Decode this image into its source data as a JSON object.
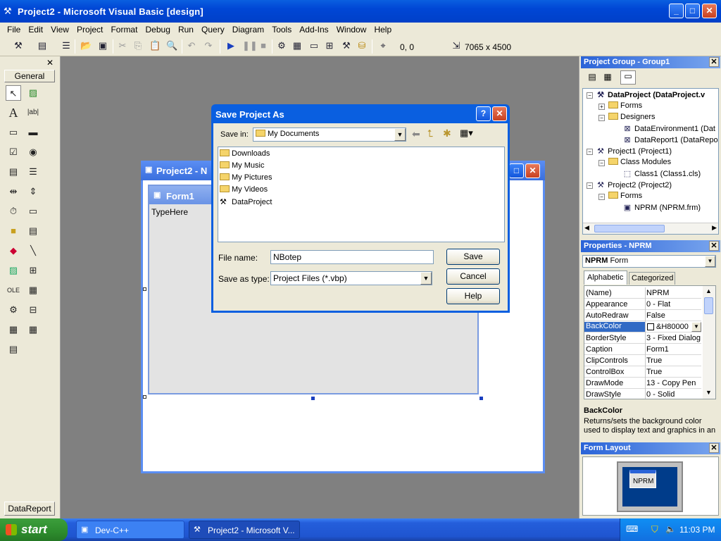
{
  "window": {
    "title": "Project2 - Microsoft Visual Basic [design]"
  },
  "menu": [
    "File",
    "Edit",
    "View",
    "Project",
    "Format",
    "Debug",
    "Run",
    "Query",
    "Diagram",
    "Tools",
    "Add-Ins",
    "Window",
    "Help"
  ],
  "toolbar": {
    "position": "0, 0",
    "size": "7065 x 4500"
  },
  "toolbox": {
    "tab_label": "General",
    "bottom_label": "DataReport"
  },
  "project_window": {
    "title": "Project2 - N",
    "form_title": "Form1",
    "form_text": "TypeHere"
  },
  "dialog": {
    "title": "Save Project As",
    "save_in_label": "Save in:",
    "save_in_value": "My Documents",
    "files": [
      "Downloads",
      "My Music",
      "My Pictures",
      "My Videos",
      "DataProject"
    ],
    "file_name_label": "File name:",
    "file_name_value": "NBotep",
    "save_type_label": "Save as type:",
    "save_type_value": "Project Files (*.vbp)",
    "save_button": "Save",
    "cancel_button": "Cancel",
    "help_button": "Help"
  },
  "project_group": {
    "title": "Project Group - Group1",
    "tree": [
      "DataProject (DataProject.v",
      "Forms",
      "Designers",
      "DataEnvironment1 (Dat",
      "DataReport1 (DataRepo",
      "Project1 (Project1)",
      "Class Modules",
      "Class1 (Class1.cls)",
      "Project2 (Project2)",
      "Forms",
      "NPRM (NPRM.frm)"
    ]
  },
  "properties": {
    "title": "Properties - NPRM",
    "object_bold": "NPRM",
    "object_type": "Form",
    "tab_alphabetic": "Alphabetic",
    "tab_categorized": "Categorized",
    "rows": [
      {
        "name": "(Name)",
        "value": "NPRM"
      },
      {
        "name": "Appearance",
        "value": "0 - Flat"
      },
      {
        "name": "AutoRedraw",
        "value": "False"
      },
      {
        "name": "BackColor",
        "value": "&H80000"
      },
      {
        "name": "BorderStyle",
        "value": "3 - Fixed Dialog"
      },
      {
        "name": "Caption",
        "value": "Form1"
      },
      {
        "name": "ClipControls",
        "value": "True"
      },
      {
        "name": "ControlBox",
        "value": "True"
      },
      {
        "name": "DrawMode",
        "value": "13 - Copy Pen"
      },
      {
        "name": "DrawStyle",
        "value": "0 - Solid"
      }
    ],
    "desc_title": "BackColor",
    "desc_text": "Returns/sets the background color used to display text and graphics in an"
  },
  "form_layout": {
    "title": "Form Layout",
    "form_label": "NPRM"
  },
  "taskbar": {
    "start": "start",
    "tasks": [
      "Dev-C++",
      "Project2 - Microsoft V..."
    ],
    "clock": "11:03 PM"
  },
  "colors": {
    "xp_blue": "#0a5fe0",
    "xp_face": "#ece9d8",
    "start_green": "#2d8c2d",
    "selection": "#316ac5"
  }
}
